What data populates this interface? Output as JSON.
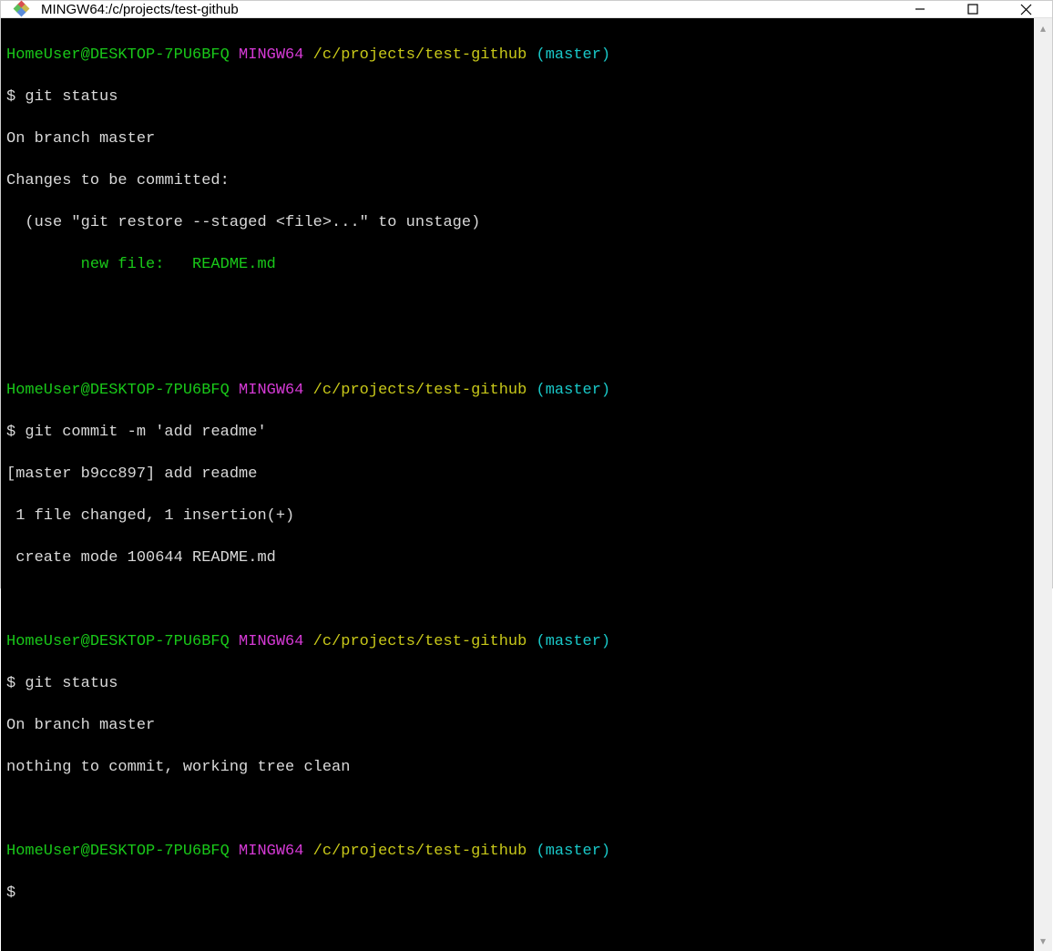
{
  "window": {
    "title": "MINGW64:/c/projects/test-github"
  },
  "prompt": {
    "userhost": "HomeUser@DESKTOP-7PU6BFQ",
    "shell": "MINGW64",
    "path": "/c/projects/test-github",
    "branch": "(master)",
    "sigil": "$ "
  },
  "block1": {
    "cmd": "git status",
    "out1": "On branch master",
    "out2": "Changes to be committed:",
    "out3": "  (use \"git restore --staged <file>...\" to unstage)",
    "out4": "        new file:   README.md"
  },
  "block2": {
    "cmd": "git commit -m 'add readme'",
    "out1": "[master b9cc897] add readme",
    "out2": " 1 file changed, 1 insertion(+)",
    "out3": " create mode 100644 README.md"
  },
  "block3": {
    "cmd": "git status",
    "out1": "On branch master",
    "out2": "nothing to commit, working tree clean"
  }
}
